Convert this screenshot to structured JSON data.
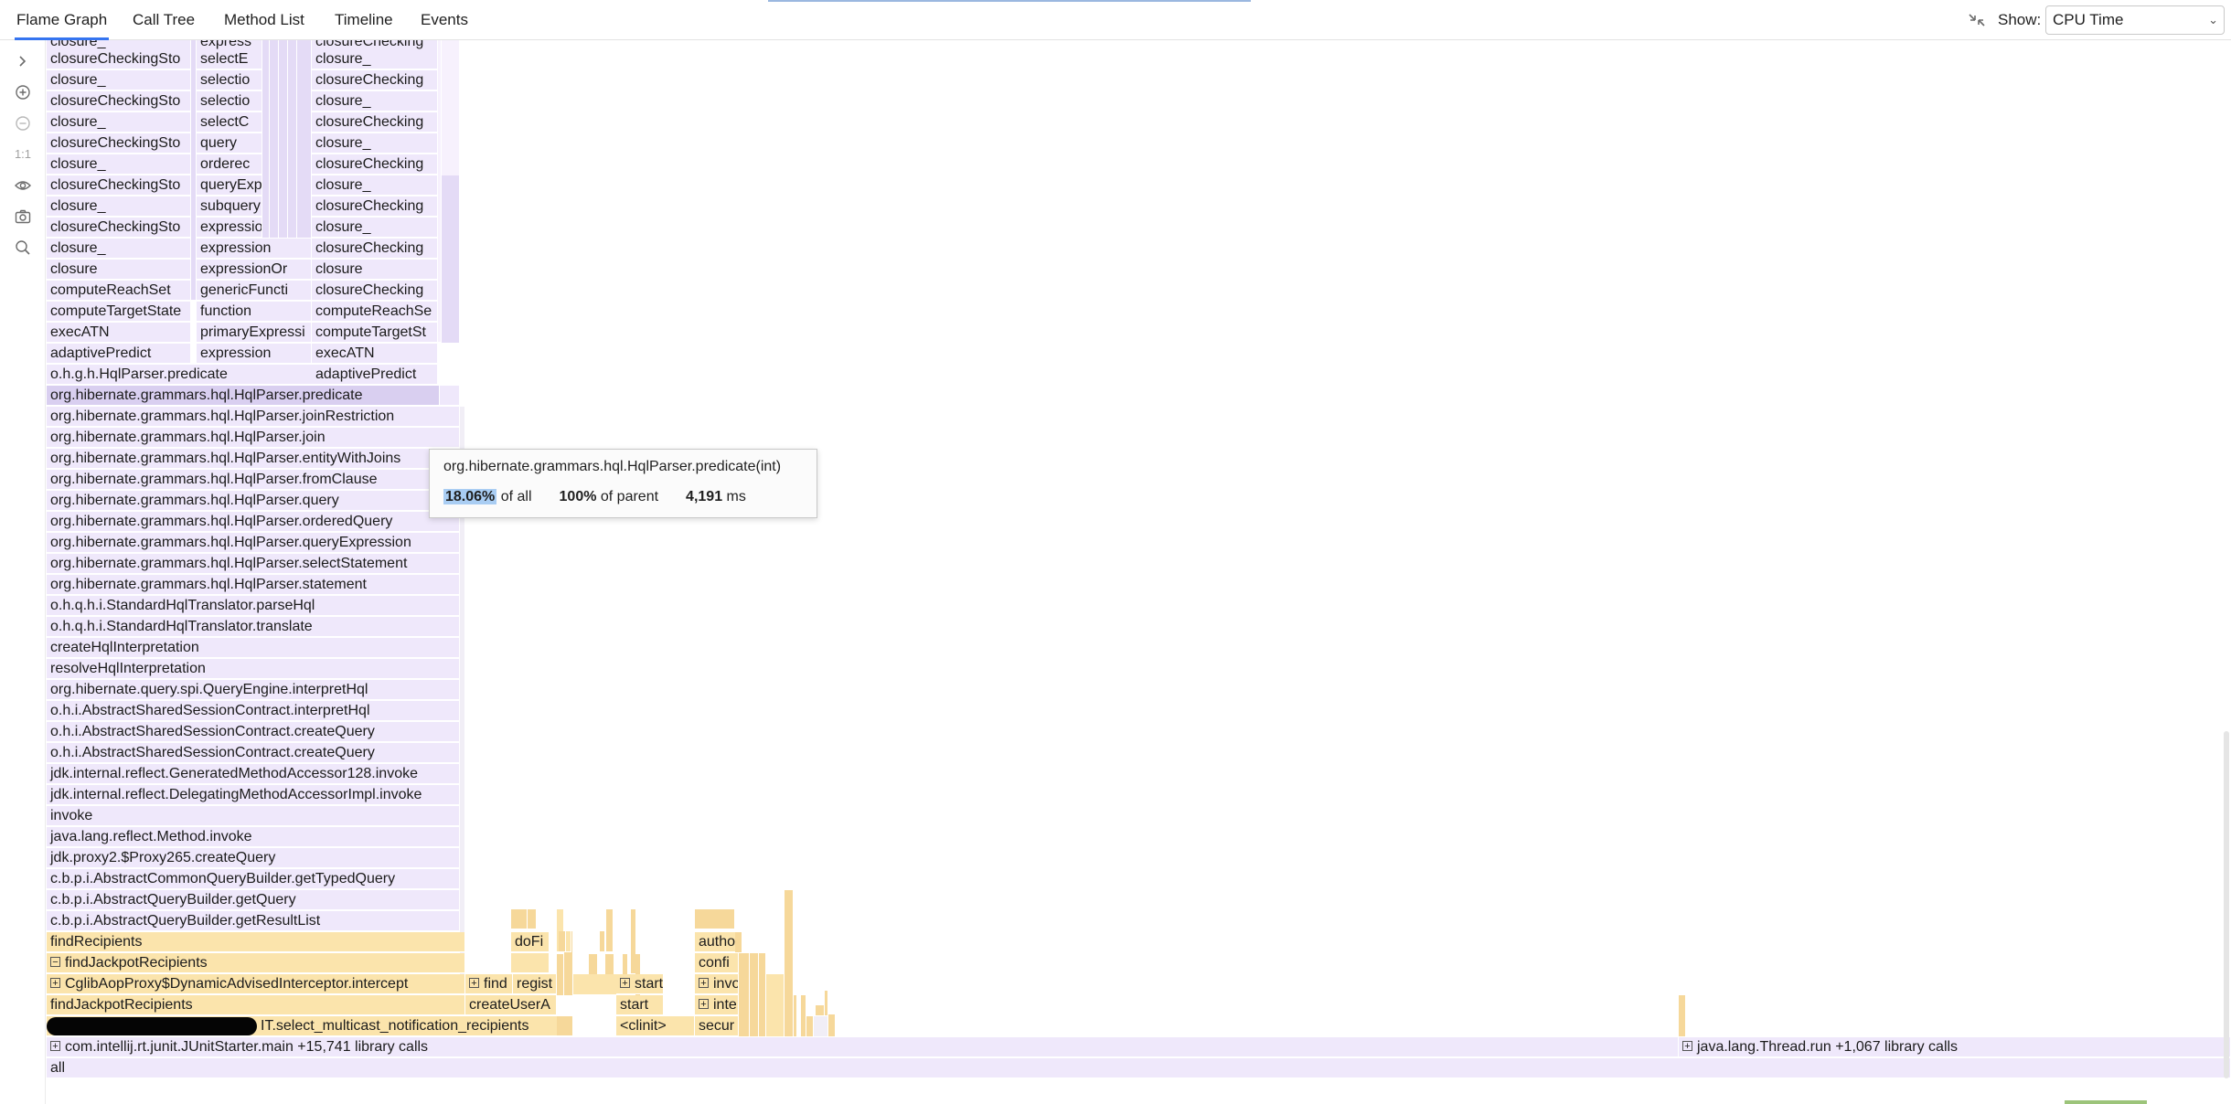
{
  "tabs": [
    {
      "label": "Flame Graph",
      "selected": true
    },
    {
      "label": "Call Tree",
      "selected": false
    },
    {
      "label": "Method List",
      "selected": false
    },
    {
      "label": "Timeline",
      "selected": false
    },
    {
      "label": "Events",
      "selected": false
    }
  ],
  "show": {
    "label": "Show:",
    "value": "CPU Time"
  },
  "toolbar": {
    "one_to_one": "1:1"
  },
  "colors": {
    "accent": "#3574f0",
    "purple_frame": "#efe8fb",
    "yellow_frame": "#fbe4ac",
    "tooltip_highlight": "#a9cdf3"
  },
  "frames": {
    "c1": [
      "closureCheckingSto",
      "closure_",
      "closureCheckingSto",
      "closure_",
      "closureCheckingSto",
      "closure_",
      "closureCheckingSto",
      "closure_",
      "closureCheckingSto",
      "closure_",
      "closure",
      "computeReachSet",
      "computeTargetState",
      "execATN",
      "adaptivePredict",
      "o.h.g.h.HqlParser.predicate"
    ],
    "c1_top": "closure_",
    "c2": [
      "selectE",
      "selectio",
      "selectio",
      "selectC",
      "query",
      "orderec",
      "queryExp",
      "subquery",
      "expressio",
      "expression",
      "expressionOr",
      "genericFuncti",
      "function",
      "primaryExpressi",
      "expression"
    ],
    "c2_top": "express",
    "c3": [
      "closure_",
      "closureChecking",
      "closure_",
      "closureChecking",
      "closure_",
      "closureChecking",
      "closure_",
      "closureChecking",
      "closure_",
      "closureChecking",
      "closure",
      "closureChecking",
      "computeReachSe",
      "computeTargetSt",
      "execATN",
      "adaptivePredict"
    ],
    "c3_top": "closureChecking",
    "main": [
      "org.hibernate.grammars.hql.HqlParser.predicate",
      "org.hibernate.grammars.hql.HqlParser.joinRestriction",
      "org.hibernate.grammars.hql.HqlParser.join",
      "org.hibernate.grammars.hql.HqlParser.entityWithJoins",
      "org.hibernate.grammars.hql.HqlParser.fromClause",
      "org.hibernate.grammars.hql.HqlParser.query",
      "org.hibernate.grammars.hql.HqlParser.orderedQuery",
      "org.hibernate.grammars.hql.HqlParser.queryExpression",
      "org.hibernate.grammars.hql.HqlParser.selectStatement",
      "org.hibernate.grammars.hql.HqlParser.statement",
      "o.h.q.h.i.StandardHqlTranslator.parseHql",
      "o.h.q.h.i.StandardHqlTranslator.translate",
      "createHqlInterpretation",
      "resolveHqlInterpretation",
      "org.hibernate.query.spi.QueryEngine.interpretHql",
      "o.h.i.AbstractSharedSessionContract.interpretHql",
      "o.h.i.AbstractSharedSessionContract.createQuery",
      "o.h.i.AbstractSharedSessionContract.createQuery",
      "jdk.internal.reflect.GeneratedMethodAccessor128.invoke",
      "jdk.internal.reflect.DelegatingMethodAccessorImpl.invoke",
      "invoke",
      "java.lang.reflect.Method.invoke",
      "jdk.proxy2.$Proxy265.createQuery",
      "c.b.p.i.AbstractCommonQueryBuilder.getTypedQuery",
      "c.b.p.i.AbstractQueryBuilder.getQuery",
      "c.b.p.i.AbstractQueryBuilder.getResultList"
    ],
    "y_findRecipients": "findRecipients",
    "y_findJackpotRecipients_collapsed": "findJackpotRecipients",
    "y_cglib": "CglibAopProxy$DynamicAdvisedInterceptor.intercept",
    "y_findJackpotRecipients": "findJackpotRecipients",
    "y_select": "IT.select_multicast_notification_recipients",
    "junit": "com.intellij.rt.junit.JUnitStarter.main +15,741 library calls",
    "thread": "java.lang.Thread.run +1,067 library calls",
    "all": "all",
    "sm_doFi": "doFi",
    "sm_find": "find",
    "sm_regist": "regist",
    "sm_createUserA": "createUserA",
    "sm_start1": "start",
    "sm_start2": "start",
    "sm_clinit": "<clinit>",
    "sm_autho": "autho",
    "sm_confi": "confi",
    "sm_invo": "invo",
    "sm_inte": "inte",
    "sm_secur": "secur"
  },
  "tooltip": {
    "title": "org.hibernate.grammars.hql.HqlParser.predicate(int)",
    "pct_all": "18.06%",
    "of_all": "of all",
    "pct_parent": "100%",
    "of_parent": "of parent",
    "ms": "4,191",
    "ms_unit": "ms"
  }
}
